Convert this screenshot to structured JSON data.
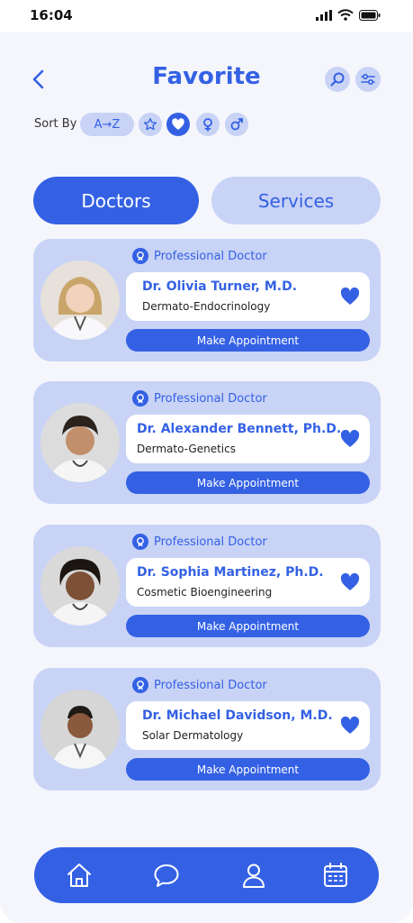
{
  "status_bar": {
    "time": "16:04"
  },
  "header": {
    "title": "Favorite"
  },
  "sort": {
    "label": "Sort By",
    "az_label": "A→Z"
  },
  "tabs": [
    {
      "label": "Doctors",
      "active": true
    },
    {
      "label": "Services",
      "active": false
    }
  ],
  "doctors": [
    {
      "badge": "Professional Doctor",
      "name": "Dr. Olivia Turner, M.D.",
      "specialty": "Dermato-Endocrinology",
      "button": "Make Appointment",
      "favorited": true
    },
    {
      "badge": "Professional Doctor",
      "name": "Dr. Alexander Bennett, Ph.D.",
      "specialty": "Dermato-Genetics",
      "button": "Make Appointment",
      "favorited": true
    },
    {
      "badge": "Professional Doctor",
      "name": "Dr. Sophia Martinez, Ph.D.",
      "specialty": "Cosmetic Bioengineering",
      "button": "Make Appointment",
      "favorited": true
    },
    {
      "badge": "Professional Doctor",
      "name": "Dr. Michael Davidson, M.D.",
      "specialty": "Solar Dermatology",
      "button": "Make Appointment",
      "favorited": true
    }
  ],
  "colors": {
    "primary": "#3461e4",
    "light": "#c8d3f6",
    "background": "#f5f6fc"
  },
  "icons": [
    "back-icon",
    "search-icon",
    "filter-icon",
    "star-icon",
    "heart-icon",
    "female-icon",
    "male-icon",
    "award-icon",
    "home-icon",
    "chat-icon",
    "profile-icon",
    "calendar-icon"
  ]
}
